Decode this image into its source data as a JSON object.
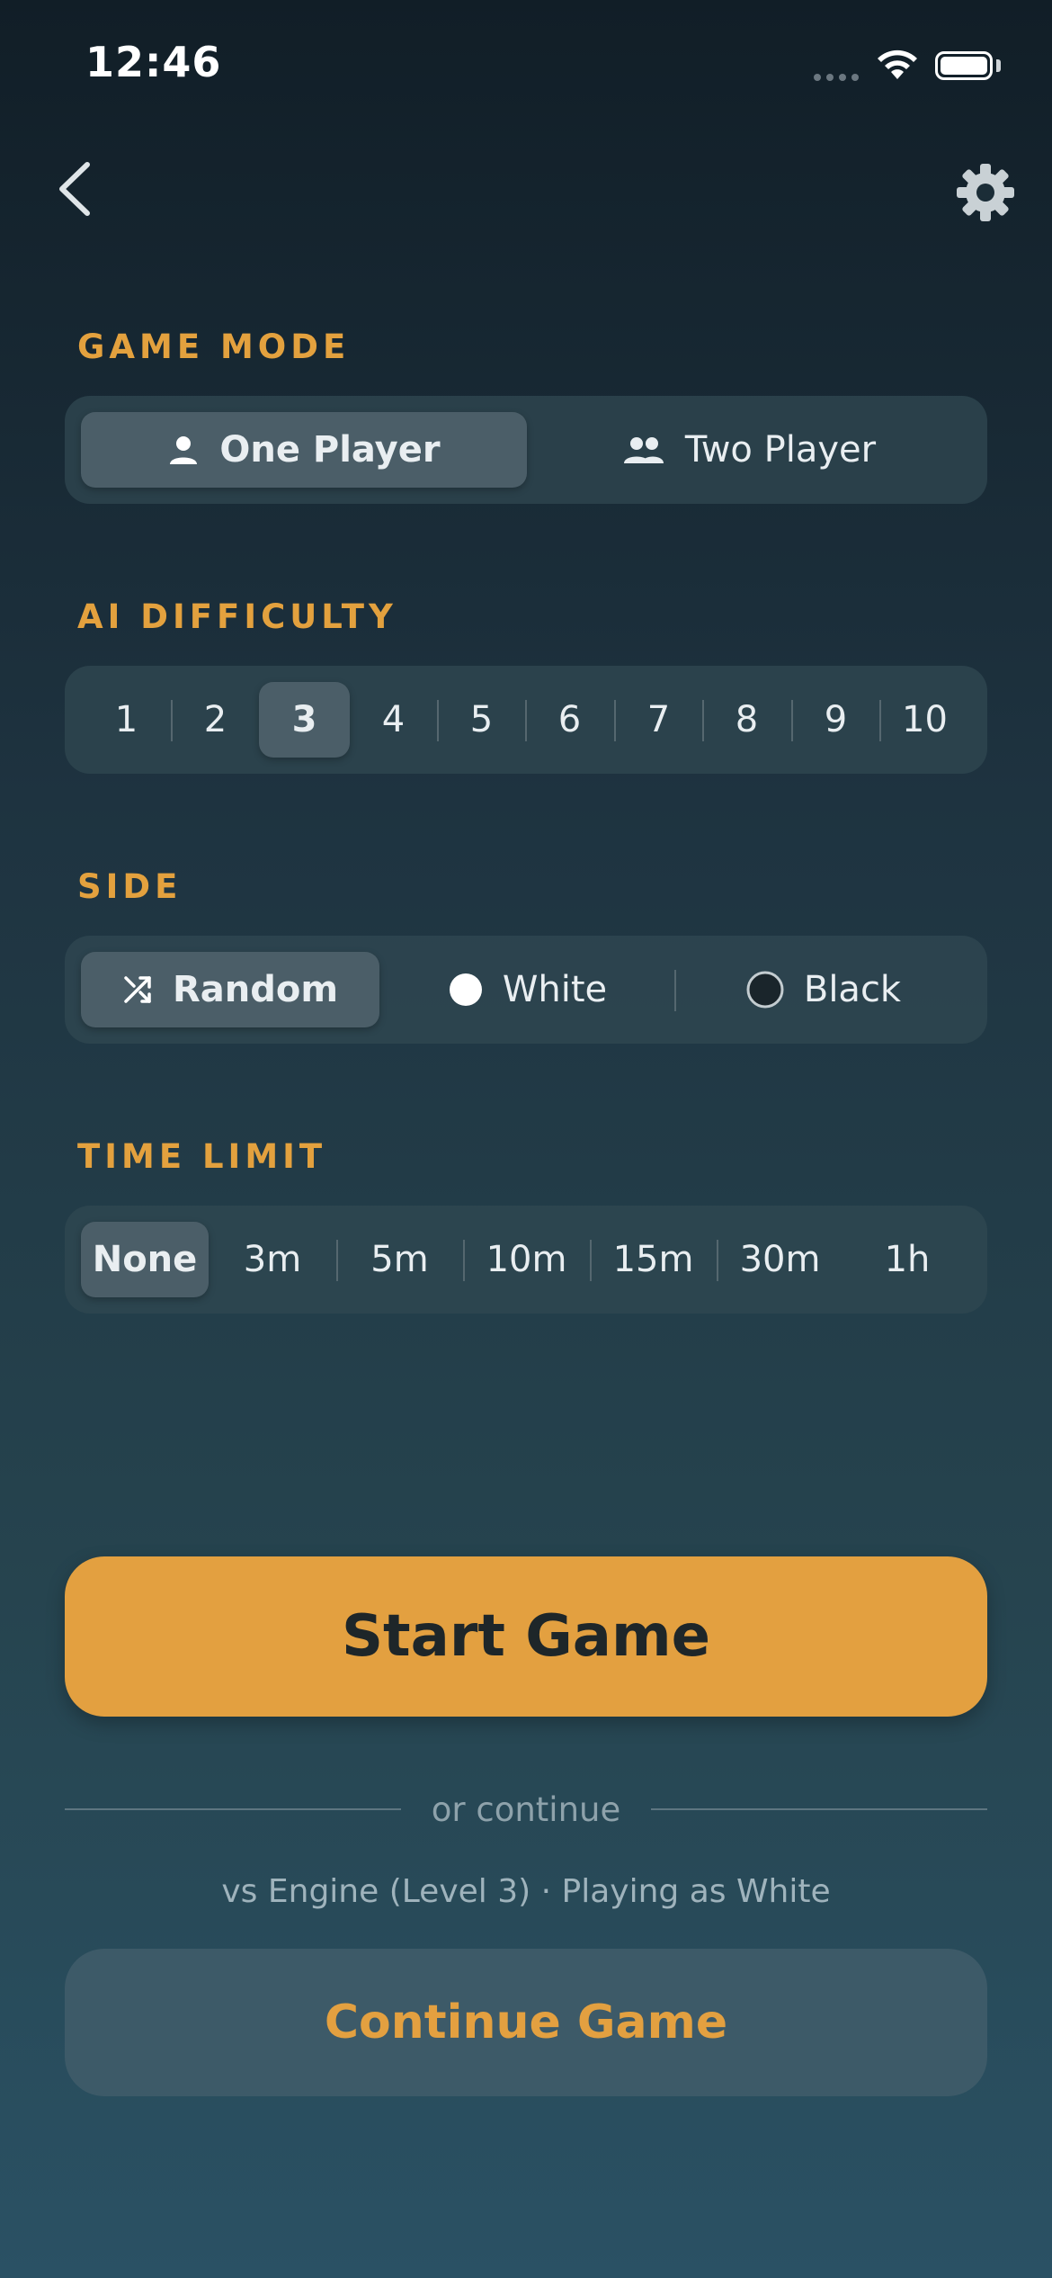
{
  "status_bar": {
    "time": "12:46"
  },
  "nav": {
    "back_icon": "chevron-left-icon",
    "settings_icon": "gear-icon"
  },
  "game_mode": {
    "label": "GAME MODE",
    "options": [
      {
        "label": "One Player",
        "icon": "person-icon",
        "selected": true
      },
      {
        "label": "Two Player",
        "icon": "people-icon",
        "selected": false
      }
    ]
  },
  "ai_difficulty": {
    "label": "AI DIFFICULTY",
    "options": [
      "1",
      "2",
      "3",
      "4",
      "5",
      "6",
      "7",
      "8",
      "9",
      "10"
    ],
    "selected": "3"
  },
  "side": {
    "label": "SIDE",
    "options": [
      {
        "label": "Random",
        "icon": "shuffle-icon",
        "selected": true
      },
      {
        "label": "White",
        "icon": "white-circle-icon",
        "selected": false
      },
      {
        "label": "Black",
        "icon": "black-circle-icon",
        "selected": false
      }
    ]
  },
  "time_limit": {
    "label": "TIME LIMIT",
    "options": [
      "None",
      "3m",
      "5m",
      "10m",
      "15m",
      "30m",
      "1h"
    ],
    "selected": "None"
  },
  "actions": {
    "start_label": "Start Game",
    "or_text": "or continue",
    "summary": "vs Engine (Level 3) · Playing as White",
    "continue_label": "Continue Game"
  },
  "colors": {
    "accent": "#e3a040",
    "section_label": "#e3a13e",
    "selected_segment": "#4b5e68"
  }
}
